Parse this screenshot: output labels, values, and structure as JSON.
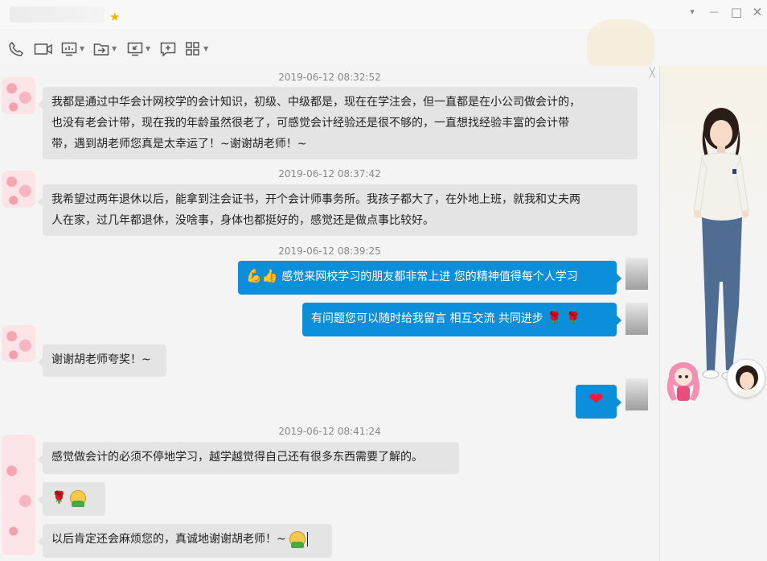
{
  "window": {
    "controls": {
      "dropdown": "▾",
      "minimize": "—",
      "maximize": "□",
      "close": "✕"
    }
  },
  "toolbar": {
    "icons": [
      "phone-icon",
      "video-icon",
      "screen-share-icon",
      "file-transfer-icon",
      "remote-desktop-icon",
      "message-add-icon",
      "apps-icon"
    ]
  },
  "messages": [
    {
      "type": "timestamp",
      "text": "2019-06-12 08:32:52"
    },
    {
      "type": "in",
      "lines": [
        "我都是通过中华会计网校学的会计知识，初级、中级都是，现在在学注会，但一直都是在小公司做会计的，",
        "也没有老会计带，现在我的年龄虽然很老了，可感觉会计经验还是很不够的，一直想找经验丰富的会计带",
        "带，遇到胡老师您真是太幸运了！~谢谢胡老师！~"
      ]
    },
    {
      "type": "timestamp",
      "text": "2019-06-12 08:37:42"
    },
    {
      "type": "in",
      "lines": [
        "我希望过两年退休以后，能拿到注会证书，开个会计师事务所。我孩子都大了，在外地上班，就我和丈夫两",
        "人在家，过几年都退休，没啥事，身体也都挺好的，感觉还是做点事比较好。"
      ]
    },
    {
      "type": "timestamp",
      "text": "2019-06-12 08:39:25"
    },
    {
      "type": "out",
      "text": "感觉来网校学习的朋友都非常上进  您的精神值得每个人学习"
    },
    {
      "type": "out",
      "text": "有问题您可以随时给我留言  相互交流 共同进步"
    },
    {
      "type": "in",
      "text": "谢谢胡老师夸奖！~"
    },
    {
      "type": "out",
      "text": ""
    },
    {
      "type": "timestamp",
      "text": "2019-06-12 08:41:24"
    },
    {
      "type": "in",
      "text": "感觉做会计的必须不停地学习，越学越觉得自己还有很多东西需要了解的。"
    },
    {
      "type": "in",
      "text": ""
    },
    {
      "type": "in",
      "text": "以后肯定还会麻烦您的，真诚地谢谢胡老师！~"
    }
  ],
  "emoji": {
    "rose": "🌹",
    "heart": "❤",
    "star": "★",
    "muscle": "💪",
    "thumb": "👍"
  }
}
